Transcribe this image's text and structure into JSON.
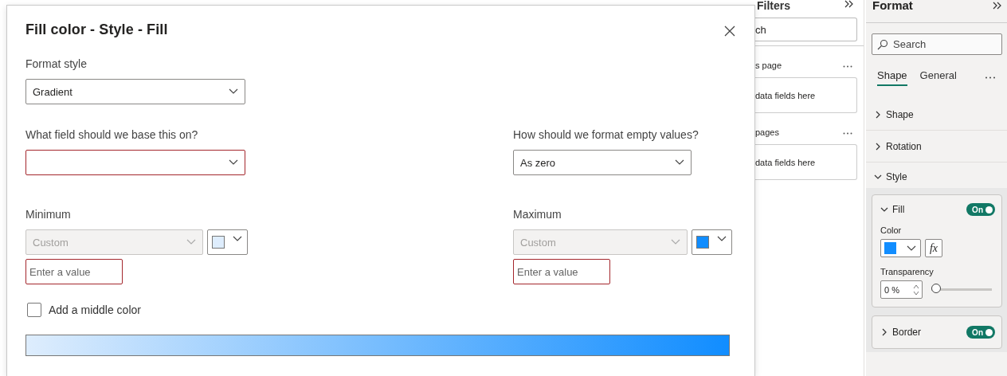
{
  "dialog": {
    "title": "Fill color - Style - Fill",
    "format_style": {
      "label": "Format style",
      "value": "Gradient"
    },
    "base_field": {
      "label": "What field should we base this on?",
      "error": true
    },
    "empty_values": {
      "label": "How should we format empty values?",
      "value": "As zero"
    },
    "bounds": [
      {
        "label": "Minimum",
        "type": {
          "value": "Custom",
          "disabled": true
        },
        "color": "#deedfd",
        "input": {
          "placeholder": "Enter a value",
          "error": true
        }
      },
      {
        "label": "Maximum",
        "type": {
          "value": "Custom",
          "disabled": true
        },
        "color": "#118dff",
        "input": {
          "placeholder": "Enter a value",
          "error": true
        }
      }
    ],
    "middle_color": {
      "label": "Add a middle color",
      "checked": false
    }
  },
  "filters_pane": {
    "title": "Filters",
    "search": {
      "value": "ch"
    },
    "sections": [
      {
        "label": "s page",
        "well": "data fields here"
      },
      {
        "label": "pages",
        "well": "data fields here"
      }
    ]
  },
  "format_pane": {
    "title": "Format",
    "search": {
      "placeholder": "Search"
    },
    "tabs": [
      {
        "label": "Shape",
        "selected": true
      },
      {
        "label": "General",
        "selected": false
      }
    ],
    "sections": [
      {
        "label": "Shape",
        "expanded": false
      },
      {
        "label": "Rotation",
        "expanded": false
      },
      {
        "label": "Style",
        "expanded": true,
        "cards": [
          {
            "kind": "fill",
            "label": "Fill",
            "expanded": true,
            "on": true,
            "toggle_text": "On",
            "color_label": "Color",
            "color": "#118dff",
            "fx": "fx",
            "transparency_label": "Transparency",
            "transparency": "0 %",
            "level": 0
          },
          {
            "kind": "border",
            "label": "Border",
            "expanded": false,
            "on": true,
            "toggle_text": "On"
          }
        ]
      }
    ]
  }
}
